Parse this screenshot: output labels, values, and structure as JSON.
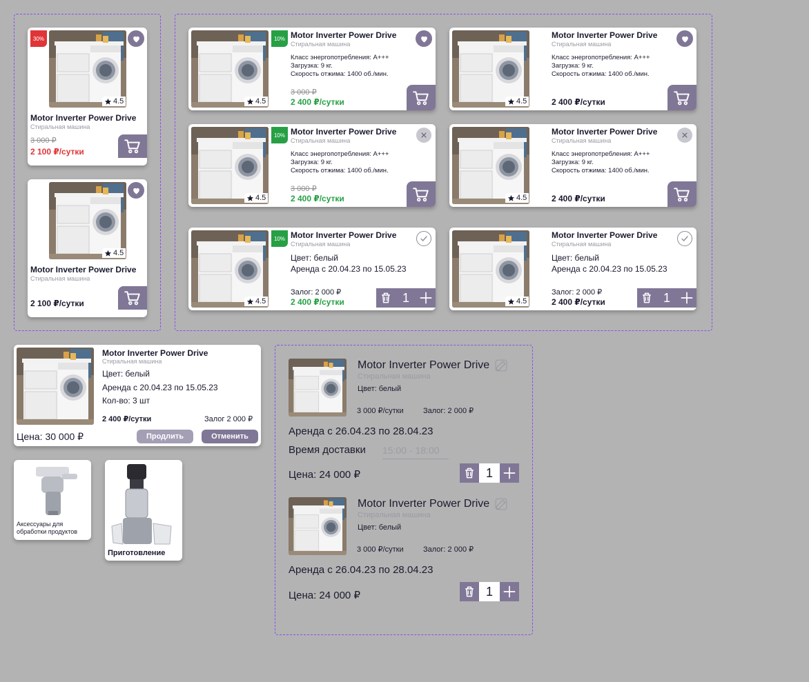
{
  "product": {
    "title": "Motor Inverter Power Drive",
    "subtitle": "Стиральная машина",
    "rating": "4.5",
    "spec_energy": "Класс энергопотребления: А+++",
    "spec_load": "Загрузка: 9 кг.",
    "spec_spin": "Скорость отжима: 1400 об./мин."
  },
  "badges": {
    "b30": "30%",
    "b10": "10%"
  },
  "prices": {
    "old": "3 000 ₽",
    "red_per_day": "2 100 ₽/сутки",
    "black_2100": "2 100 ₽/сутки",
    "green_per_day": "2 400 ₽/сутки",
    "black_2400": "2 400 ₽/сутки"
  },
  "rent": {
    "color": "Цвет: белый",
    "period": "Аренда с 20.04.23 по 15.05.23",
    "deposit": "Залог: 2 000 ₽",
    "quantity": "1"
  },
  "order": {
    "title": "Motor Inverter Power Drive",
    "subtitle": "Стиральная машина",
    "color": "Цвет: белый",
    "period": "Аренда с 20.04.23 по 15.05.23",
    "count": "Кол-во: 3 шт",
    "per_day": "2 400 ₽/сутки",
    "deposit": "Залог 2 000 ₽",
    "total": "Цена: 30 000 ₽",
    "extend_label": "Продлить",
    "cancel_label": "Отменить"
  },
  "categories": [
    {
      "label": "Аксессуары для обработки продуктов"
    },
    {
      "label": "Приготовление"
    }
  ],
  "cart": {
    "items": [
      {
        "title": "Motor Inverter Power Drive",
        "subtitle": "Стиральная машина",
        "color": "Цвет: белый",
        "price": "3 000 ₽/сутки",
        "deposit": "Залог: 2 000 ₽",
        "period": "Аренда с 26.04.23 по 28.04.23",
        "delivery_label": "Время доставки",
        "delivery_placeholder": "15:00 - 18:00",
        "total": "Цена: 24 000 ₽",
        "quantity": "1"
      },
      {
        "title": "Motor Inverter Power Drive",
        "subtitle": "Стиральная машина",
        "color": "Цвет: белый",
        "price": "3 000 ₽/сутки",
        "deposit": "Залог: 2 000 ₽",
        "period": "Аренда с 26.04.23 по 28.04.23",
        "total": "Цена: 24 000 ₽",
        "quantity": "1"
      }
    ]
  },
  "colors": {
    "accent": "#807797",
    "green": "#27a045",
    "red": "#e03538",
    "frame": "#8a4cf0",
    "background": "#b3b3b3"
  },
  "icons": [
    "heart-icon",
    "cart-icon",
    "star-icon",
    "close-icon",
    "check-icon",
    "trash-icon",
    "plus-icon",
    "edit-icon"
  ]
}
